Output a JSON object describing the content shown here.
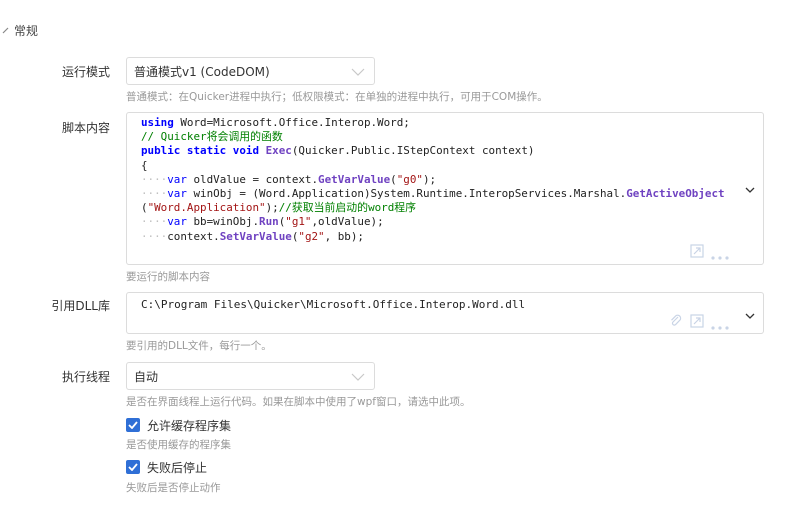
{
  "section": {
    "title": "常规"
  },
  "run_mode": {
    "label": "运行模式",
    "value": "普通模式v1 (CodeDOM)",
    "hint": "普通模式：在Quicker进程中执行；低权限模式：在单独的进程中执行，可用于COM操作。"
  },
  "script": {
    "label": "脚本内容",
    "hint": "要运行的脚本内容",
    "code_lines": [
      "using Word=Microsoft.Office.Interop.Word;",
      "// Quicker将会调用的函数",
      "public static void Exec(Quicker.Public.IStepContext context)",
      "{",
      "    var oldValue = context.GetVarValue(\"g0\");",
      "    var winObj = (Word.Application)System.Runtime.InteropServices.Marshal.GetActiveObject",
      "(\"Word.Application\");//获取当前启动的word程序",
      "    var bb=winObj.Run(\"g1\",oldValue);",
      "    context.SetVarValue(\"g2\", bb);"
    ]
  },
  "dll": {
    "label": "引用DLL库",
    "value": "C:\\Program Files\\Quicker\\Microsoft.Office.Interop.Word.dll",
    "hint": "要引用的DLL文件，每行一个。"
  },
  "thread": {
    "label": "执行线程",
    "value": "自动",
    "hint": "是否在界面线程上运行代码。如果在脚本中使用了wpf窗口，请选中此项。"
  },
  "cache": {
    "label": "允许缓存程序集",
    "checked": true,
    "hint": "是否使用缓存的程序集"
  },
  "stop_on_fail": {
    "label": "失败后停止",
    "checked": true,
    "hint": "失败后是否停止动作"
  },
  "icons": {
    "section_toggle": "chevron-icon",
    "dropdown": "chevron-down-icon",
    "expand": "expand-icon",
    "more": "more-icon",
    "attach": "paperclip-icon",
    "check": "check-icon"
  },
  "colors": {
    "accent": "#2f6fd6",
    "hint": "#999999",
    "border": "#dcdcdc"
  }
}
